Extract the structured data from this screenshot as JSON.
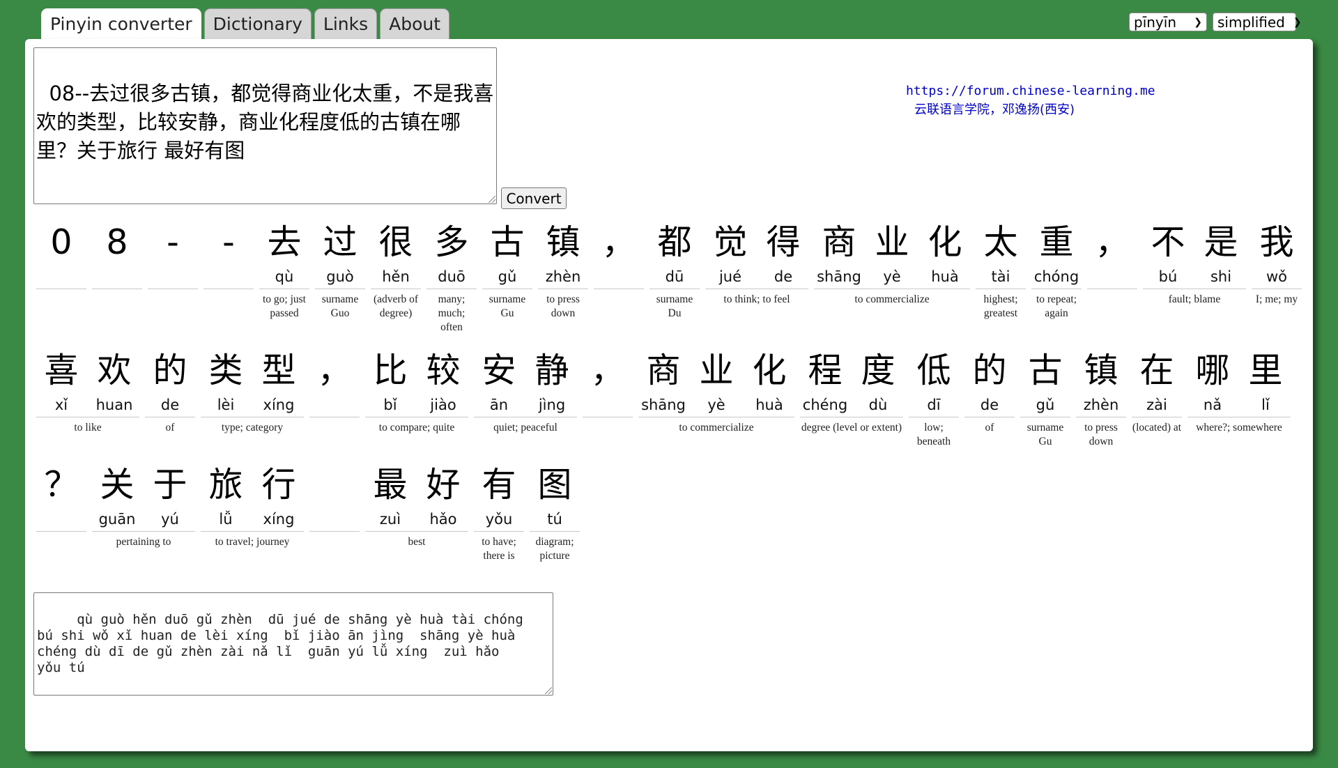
{
  "tabs": [
    {
      "label": "Pinyin converter",
      "active": true
    },
    {
      "label": "Dictionary",
      "active": false
    },
    {
      "label": "Links",
      "active": false
    },
    {
      "label": "About",
      "active": false
    }
  ],
  "selects": {
    "tone": "pīnyīn",
    "script": "simplified"
  },
  "input_text": "08--去过很多古镇，都觉得商业化太重，不是我喜欢的类型，比较安静，商业化程度低的古镇在哪里？关于旅行 最好有图",
  "convert_label": "Convert",
  "credit": {
    "url": "https://forum.chinese-learning.me",
    "author": "云联语言学院，邓逸扬(西安)"
  },
  "rows": [
    [
      {
        "chars": [
          {
            "hz": "0",
            "py": ""
          }
        ],
        "def": ""
      },
      {
        "chars": [
          {
            "hz": "8",
            "py": ""
          }
        ],
        "def": ""
      },
      {
        "chars": [
          {
            "hz": "-",
            "py": ""
          }
        ],
        "def": ""
      },
      {
        "chars": [
          {
            "hz": "-",
            "py": ""
          }
        ],
        "def": ""
      },
      {
        "chars": [
          {
            "hz": "去",
            "py": "qù"
          }
        ],
        "def": "to go; just passed"
      },
      {
        "chars": [
          {
            "hz": "过",
            "py": "guò"
          }
        ],
        "def": "surname Guo"
      },
      {
        "chars": [
          {
            "hz": "很",
            "py": "hěn"
          }
        ],
        "def": "(adverb of degree)"
      },
      {
        "chars": [
          {
            "hz": "多",
            "py": "duō"
          }
        ],
        "def": "many; much; often"
      },
      {
        "chars": [
          {
            "hz": "古",
            "py": "gǔ"
          }
        ],
        "def": "surname Gu"
      },
      {
        "chars": [
          {
            "hz": "镇",
            "py": "zhèn"
          }
        ],
        "def": "to press down"
      },
      {
        "chars": [
          {
            "hz": "，",
            "py": ""
          }
        ],
        "def": ""
      },
      {
        "chars": [
          {
            "hz": "都",
            "py": "dū"
          }
        ],
        "def": "surname Du"
      },
      {
        "chars": [
          {
            "hz": "觉",
            "py": "jué"
          },
          {
            "hz": "得",
            "py": "de"
          }
        ],
        "def": "to think; to feel"
      },
      {
        "chars": [
          {
            "hz": "商",
            "py": "shāng"
          },
          {
            "hz": "业",
            "py": "yè"
          },
          {
            "hz": "化",
            "py": "huà"
          }
        ],
        "def": "to commercialize"
      },
      {
        "chars": [
          {
            "hz": "太",
            "py": "tài"
          }
        ],
        "def": "highest; greatest"
      },
      {
        "chars": [
          {
            "hz": "重",
            "py": "chóng"
          }
        ],
        "def": "to repeat; again"
      },
      {
        "chars": [
          {
            "hz": "，",
            "py": ""
          }
        ],
        "def": ""
      },
      {
        "chars": [
          {
            "hz": "不",
            "py": "bú"
          },
          {
            "hz": "是",
            "py": "shi"
          }
        ],
        "def": "fault; blame"
      },
      {
        "chars": [
          {
            "hz": "我",
            "py": "wǒ"
          }
        ],
        "def": "I; me; my"
      }
    ],
    [
      {
        "chars": [
          {
            "hz": "喜",
            "py": "xǐ"
          },
          {
            "hz": "欢",
            "py": "huan"
          }
        ],
        "def": "to like"
      },
      {
        "chars": [
          {
            "hz": "的",
            "py": "de"
          }
        ],
        "def": "of"
      },
      {
        "chars": [
          {
            "hz": "类",
            "py": "lèi"
          },
          {
            "hz": "型",
            "py": "xíng"
          }
        ],
        "def": "type; category"
      },
      {
        "chars": [
          {
            "hz": "，",
            "py": ""
          }
        ],
        "def": ""
      },
      {
        "chars": [
          {
            "hz": "比",
            "py": "bǐ"
          },
          {
            "hz": "较",
            "py": "jiào"
          }
        ],
        "def": "to compare; quite"
      },
      {
        "chars": [
          {
            "hz": "安",
            "py": "ān"
          },
          {
            "hz": "静",
            "py": "jìng"
          }
        ],
        "def": "quiet; peaceful"
      },
      {
        "chars": [
          {
            "hz": "，",
            "py": ""
          }
        ],
        "def": ""
      },
      {
        "chars": [
          {
            "hz": "商",
            "py": "shāng"
          },
          {
            "hz": "业",
            "py": "yè"
          },
          {
            "hz": "化",
            "py": "huà"
          }
        ],
        "def": "to commercialize"
      },
      {
        "chars": [
          {
            "hz": "程",
            "py": "chéng"
          },
          {
            "hz": "度",
            "py": "dù"
          }
        ],
        "def": "degree (level or extent)"
      },
      {
        "chars": [
          {
            "hz": "低",
            "py": "dī"
          }
        ],
        "def": "low; beneath"
      },
      {
        "chars": [
          {
            "hz": "的",
            "py": "de"
          }
        ],
        "def": "of"
      },
      {
        "chars": [
          {
            "hz": "古",
            "py": "gǔ"
          }
        ],
        "def": "surname Gu"
      },
      {
        "chars": [
          {
            "hz": "镇",
            "py": "zhèn"
          }
        ],
        "def": "to press down"
      },
      {
        "chars": [
          {
            "hz": "在",
            "py": "zài"
          }
        ],
        "def": "(located) at"
      },
      {
        "chars": [
          {
            "hz": "哪",
            "py": "nǎ"
          },
          {
            "hz": "里",
            "py": "lǐ"
          }
        ],
        "def": "where?; somewhere"
      }
    ],
    [
      {
        "chars": [
          {
            "hz": "？",
            "py": ""
          }
        ],
        "def": ""
      },
      {
        "chars": [
          {
            "hz": "关",
            "py": "guān"
          },
          {
            "hz": "于",
            "py": "yú"
          }
        ],
        "def": "pertaining to"
      },
      {
        "chars": [
          {
            "hz": "旅",
            "py": "lǚ"
          },
          {
            "hz": "行",
            "py": "xíng"
          }
        ],
        "def": "to travel; journey"
      },
      {
        "chars": [
          {
            "hz": " ",
            "py": ""
          }
        ],
        "def": ""
      },
      {
        "chars": [
          {
            "hz": "最",
            "py": "zuì"
          },
          {
            "hz": "好",
            "py": "hǎo"
          }
        ],
        "def": "best"
      },
      {
        "chars": [
          {
            "hz": "有",
            "py": "yǒu"
          }
        ],
        "def": "to have; there is"
      },
      {
        "chars": [
          {
            "hz": "图",
            "py": "tú"
          }
        ],
        "def": "diagram; picture"
      }
    ]
  ],
  "output_text": "   qù guò hěn duō gǔ zhèn  dū jué de shāng yè huà tài chóng\nbú shi wǒ xǐ huan de lèi xíng  bǐ jiào ān jìng  shāng yè huà\nchéng dù dī de gǔ zhèn zài nǎ lǐ  guān yú lǚ xíng  zuì hǎo\nyǒu tú"
}
